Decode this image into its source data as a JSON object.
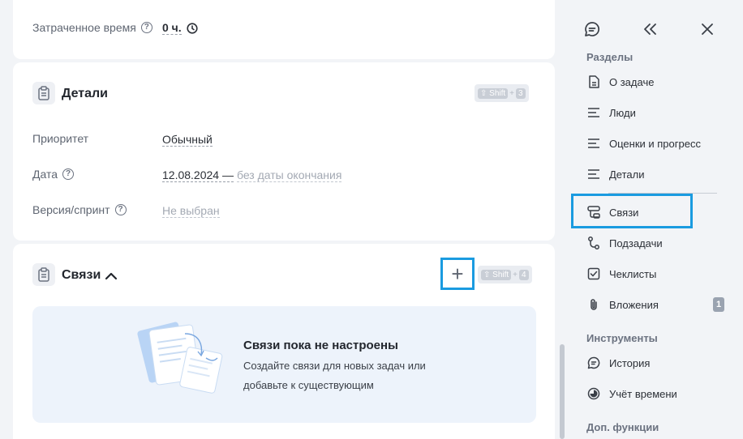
{
  "top": {
    "spent_time_label": "Затраченное время",
    "spent_time_value": "0 ч."
  },
  "details": {
    "title": "Детали",
    "hotkey_key": "⇧ Shift",
    "hotkey_plus": "+",
    "hotkey_num": "3",
    "priority_label": "Приоритет",
    "priority_value": "Обычный",
    "date_label": "Дата",
    "date_start": "12.08.2024 —",
    "date_end": "без даты окончания",
    "version_label": "Версия/спринт",
    "version_value": "Не выбран"
  },
  "links": {
    "title": "Связи",
    "add_label": "+",
    "hotkey_key": "⇧ Shift",
    "hotkey_plus": "+",
    "hotkey_num": "4",
    "empty_title": "Связи пока не настроены",
    "empty_desc": "Создайте связи для новых задач или добавьте к существующим"
  },
  "sidebar": {
    "groups": [
      {
        "title": "Разделы"
      },
      {
        "title": "Инструменты"
      },
      {
        "title": "Доп. функции"
      }
    ],
    "items": [
      {
        "label": "О задаче",
        "icon": "document-icon"
      },
      {
        "label": "Люди",
        "icon": "lines-icon"
      },
      {
        "label": "Оценки и прогресс",
        "icon": "lines-icon"
      },
      {
        "label": "Детали",
        "icon": "lines-icon"
      },
      {
        "label": "Связи",
        "icon": "links-icon"
      },
      {
        "label": "Подзадачи",
        "icon": "subtasks-icon"
      },
      {
        "label": "Чеклисты",
        "icon": "checklist-icon"
      },
      {
        "label": "Вложения",
        "icon": "paperclip-icon",
        "badge": "1"
      },
      {
        "label": "История",
        "icon": "chat-icon"
      },
      {
        "label": "Учёт времени",
        "icon": "timer-icon"
      }
    ]
  },
  "colors": {
    "accent_highlight": "#1a9be0",
    "empty_bg": "#edf3fb"
  }
}
